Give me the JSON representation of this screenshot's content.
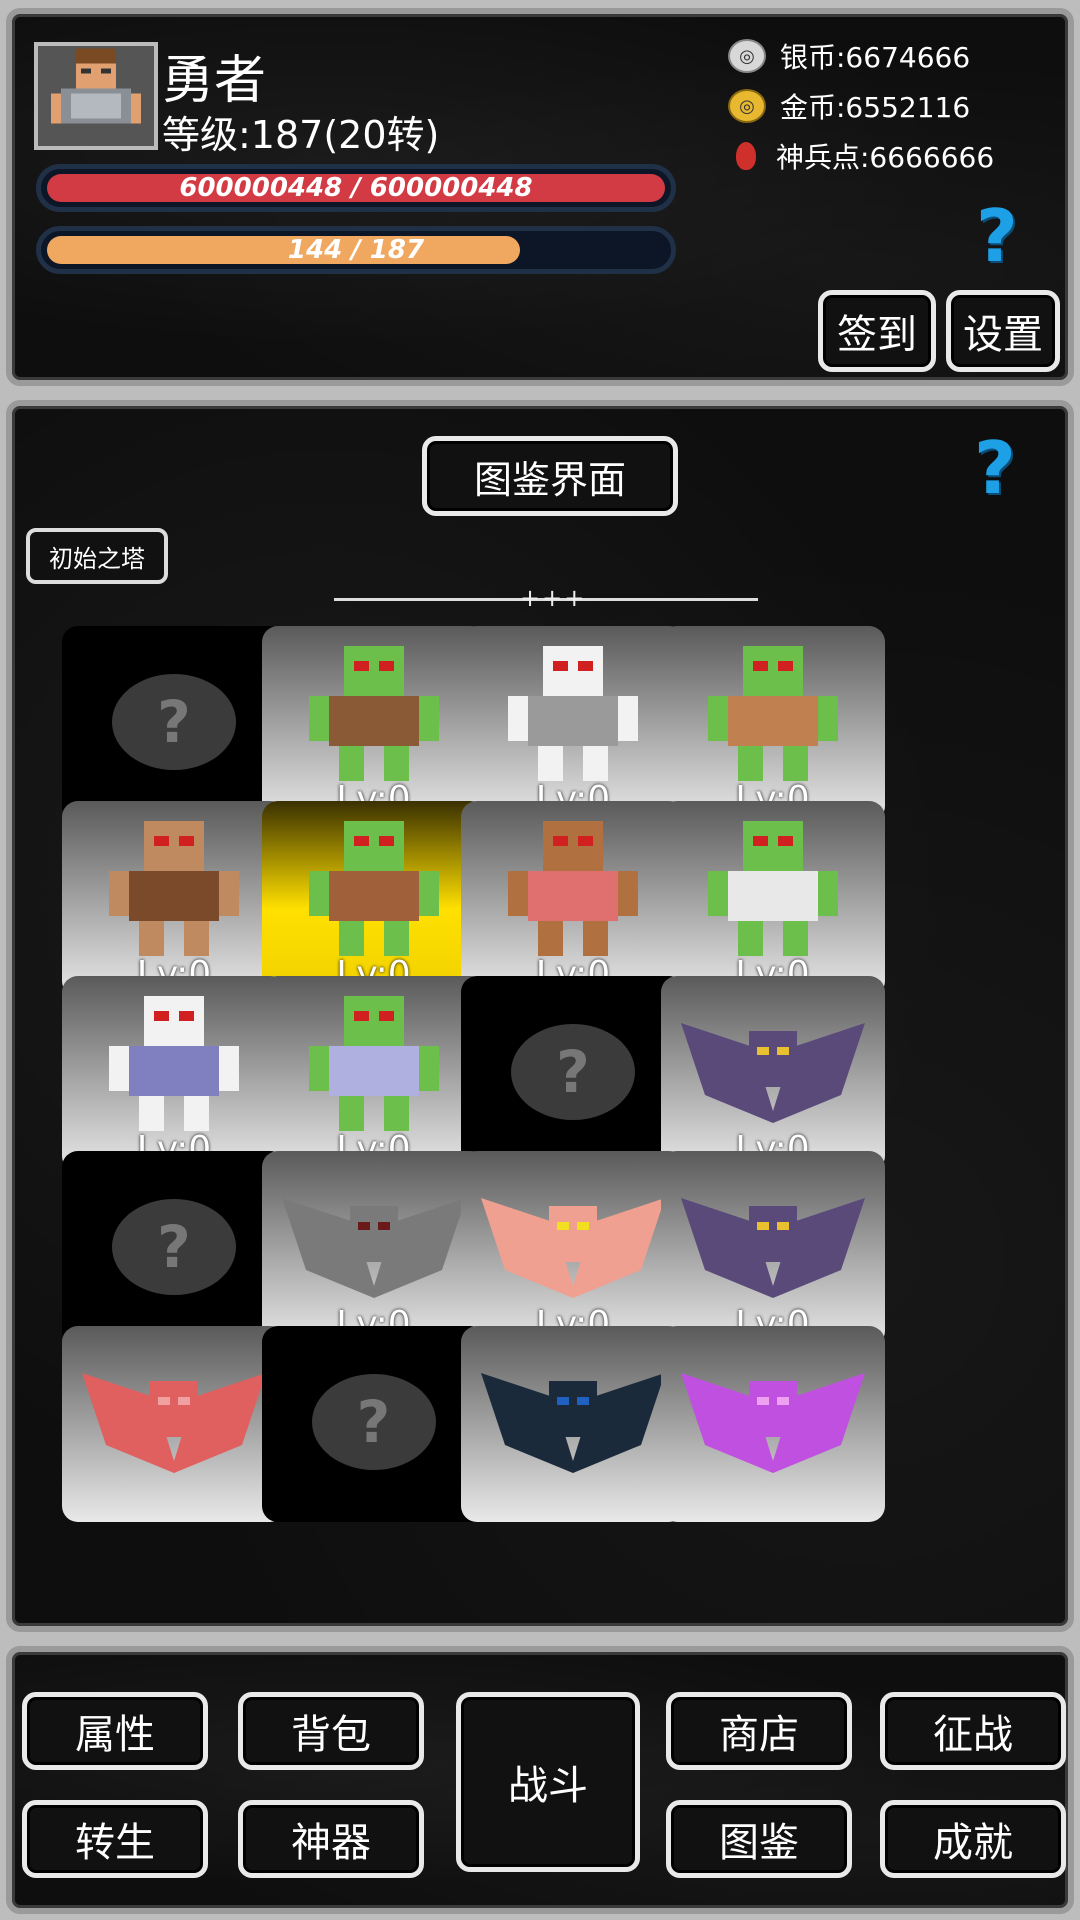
{
  "player": {
    "name": "勇者",
    "level": "等级:187(20转)",
    "hp_text": "600000448 / 600000448",
    "hp_fraction": 1.0,
    "exp_text": "144 / 187",
    "exp_fraction": 0.77
  },
  "currencies": {
    "silver": "银币:6674666",
    "gold": "金币:6552116",
    "shenbing": "神兵点:6666666"
  },
  "buttons": {
    "checkin": "签到",
    "settings": "设置"
  },
  "codex": {
    "title": "图鉴界面",
    "tower": "初始之塔",
    "divider_mark": "+++",
    "locked_mark": "?"
  },
  "cards": [
    {
      "state": "locked",
      "lv": "",
      "creature": "unknown"
    },
    {
      "state": "normal",
      "lv": "Lv:0",
      "creature": "goblin-club"
    },
    {
      "state": "normal",
      "lv": "Lv:0",
      "creature": "skeleton"
    },
    {
      "state": "normal",
      "lv": "Lv:0",
      "creature": "goblin-axe-shield"
    },
    {
      "state": "normal",
      "lv": "Lv:0",
      "creature": "mummy-brute"
    },
    {
      "state": "gold",
      "lv": "Lv:0",
      "creature": "goblin-shaman"
    },
    {
      "state": "normal",
      "lv": "Lv:0",
      "creature": "stone-golem"
    },
    {
      "state": "normal",
      "lv": "Lv:0",
      "creature": "goblin-knight"
    },
    {
      "state": "normal",
      "lv": "Lv:0",
      "creature": "skeleton-warrior"
    },
    {
      "state": "normal",
      "lv": "Lv:0",
      "creature": "goblin-paladin"
    },
    {
      "state": "locked",
      "lv": "",
      "creature": "unknown"
    },
    {
      "state": "normal",
      "lv": "Lv:0",
      "creature": "purple-bat"
    },
    {
      "state": "locked",
      "lv": "",
      "creature": "unknown"
    },
    {
      "state": "normal",
      "lv": "Lv:0",
      "creature": "gray-demon-bat"
    },
    {
      "state": "normal",
      "lv": "Lv:0",
      "creature": "pink-demon-bat"
    },
    {
      "state": "normal",
      "lv": "Lv:0",
      "creature": "violet-bat"
    },
    {
      "state": "normal",
      "lv": "",
      "creature": "red-demon-bat"
    },
    {
      "state": "locked",
      "lv": "",
      "creature": "unknown"
    },
    {
      "state": "normal",
      "lv": "",
      "creature": "dark-bat"
    },
    {
      "state": "normal",
      "lv": "",
      "creature": "magenta-bat"
    }
  ],
  "nav": {
    "attributes": "属性",
    "bag": "背包",
    "battle": "战斗",
    "shop": "商店",
    "campaign": "征战",
    "rebirth": "转生",
    "artifact": "神器",
    "codex": "图鉴",
    "achievements": "成就"
  },
  "colors": {
    "hp": "#d23a44",
    "exp": "#f0a860",
    "help": "#1ea0e6",
    "gold_card": "#ffe000"
  }
}
